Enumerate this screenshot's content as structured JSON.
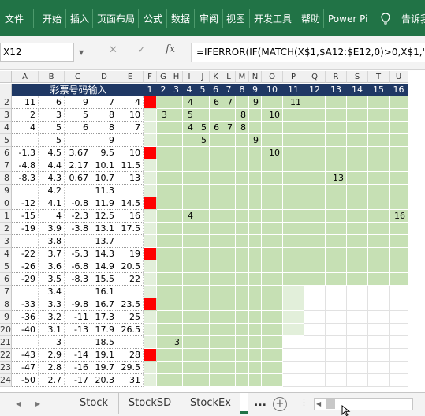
{
  "ribbon": {
    "tabs": [
      "文件",
      "开始",
      "插入",
      "页面布局",
      "公式",
      "数据",
      "审阅",
      "视图",
      "开发工具",
      "帮助",
      "Power Pi",
      "告诉我"
    ],
    "colors": {
      "bg": "#217346",
      "text": "#ffffff"
    }
  },
  "formula_bar": {
    "name_box": "X12",
    "cancel_icon": "✕",
    "enter_icon": "✓",
    "fx_label": "fx",
    "formula": "=IFERROR(IF(MATCH(X$1,$A12:$E12,0)>0,X$1,\"\"),\"\")"
  },
  "columns": [
    "A",
    "B",
    "C",
    "D",
    "E",
    "F",
    "G",
    "H",
    "I",
    "J",
    "K",
    "L",
    "M",
    "N",
    "O",
    "P",
    "Q",
    "R",
    "S",
    "T",
    "U"
  ],
  "title": "彩票号码输入",
  "header_numbers": [
    "1",
    "2",
    "3",
    "4",
    "5",
    "6",
    "7",
    "8",
    "9",
    "10",
    "11",
    "12",
    "13",
    "14",
    "15",
    "16"
  ],
  "rows": [
    {
      "num": "2",
      "a": "11",
      "b": "6",
      "c": "9",
      "d": "7",
      "e": "4",
      "f": "red",
      "vals": {
        "J": "4",
        "L": "6",
        "M": "7",
        "O": "9",
        "Q": "11"
      }
    },
    {
      "num": "3",
      "a": "2",
      "b": "3",
      "c": "5",
      "d": "8",
      "e": "10",
      "f": "lite",
      "vals": {
        "G": "2",
        "H": "3",
        "J": "5",
        "N": "8",
        "P": "10"
      }
    },
    {
      "num": "4",
      "a": "4",
      "b": "5",
      "c": "6",
      "d": "8",
      "e": "7",
      "f": "lite",
      "vals": {
        "J": "4",
        "K": "5",
        "L": "6",
        "M": "7",
        "N": "8"
      }
    },
    {
      "num": "5",
      "a": "",
      "b": "5",
      "c": "",
      "d": "9",
      "e": "",
      "f": "lite",
      "vals": {
        "K": "5",
        "O": "9"
      }
    },
    {
      "num": "6",
      "a": "-1.3",
      "b": "4.5",
      "c": "3.67",
      "d": "9.5",
      "e": "10",
      "f": "red",
      "vals": {
        "P": "10"
      }
    },
    {
      "num": "7",
      "a": "-4.8",
      "b": "4.4",
      "c": "2.17",
      "d": "10.1",
      "e": "11.5",
      "f": "lite",
      "vals": {}
    },
    {
      "num": "8",
      "a": "-8.3",
      "b": "4.3",
      "c": "0.67",
      "d": "10.7",
      "e": "13",
      "f": "lite",
      "vals": {
        "S": "13"
      }
    },
    {
      "num": "9",
      "a": "",
      "b": "4.2",
      "c": "",
      "d": "11.3",
      "e": "",
      "f": "lite",
      "vals": {}
    },
    {
      "num": "0",
      "a": "-12",
      "b": "4.1",
      "c": "-0.8",
      "d": "11.9",
      "e": "14.5",
      "f": "red",
      "vals": {}
    },
    {
      "num": "1",
      "a": "-15",
      "b": "4",
      "c": "-2.3",
      "d": "12.5",
      "e": "16",
      "f": "lite",
      "vals": {
        "J": "4",
        "V": "16"
      }
    },
    {
      "num": "2",
      "a": "-19",
      "b": "3.9",
      "c": "-3.8",
      "d": "13.1",
      "e": "17.5",
      "f": "lite",
      "vals": {}
    },
    {
      "num": "3",
      "a": "",
      "b": "3.8",
      "c": "",
      "d": "13.7",
      "e": "",
      "f": "lite",
      "vals": {}
    },
    {
      "num": "4",
      "a": "-22",
      "b": "3.7",
      "c": "-5.3",
      "d": "14.3",
      "e": "19",
      "f": "red",
      "vals": {}
    },
    {
      "num": "5",
      "a": "-26",
      "b": "3.6",
      "c": "-6.8",
      "d": "14.9",
      "e": "20.5",
      "f": "lite",
      "vals": {}
    },
    {
      "num": "6",
      "a": "-29",
      "b": "3.5",
      "c": "-8.3",
      "d": "15.5",
      "e": "22",
      "f": "lite",
      "vals": {}
    },
    {
      "num": "7",
      "a": "",
      "b": "3.4",
      "c": "",
      "d": "16.1",
      "e": "",
      "f": "lite",
      "vals": {}
    },
    {
      "num": "8",
      "a": "-33",
      "b": "3.3",
      "c": "-9.8",
      "d": "16.7",
      "e": "23.5",
      "f": "red",
      "vals": {}
    },
    {
      "num": "9",
      "a": "-36",
      "b": "3.2",
      "c": "-11",
      "d": "17.3",
      "e": "25",
      "f": "lite",
      "vals": {}
    },
    {
      "num": "20",
      "a": "-40",
      "b": "3.1",
      "c": "-13",
      "d": "17.9",
      "e": "26.5",
      "f": "lite",
      "vals": {}
    },
    {
      "num": "21",
      "a": "",
      "b": "3",
      "c": "",
      "d": "18.5",
      "e": "",
      "f": "lite",
      "vals": {
        "I": "3"
      }
    },
    {
      "num": "22",
      "a": "-43",
      "b": "2.9",
      "c": "-14",
      "d": "19.1",
      "e": "28",
      "f": "red",
      "vals": {}
    },
    {
      "num": "23",
      "a": "-47",
      "b": "2.8",
      "c": "-16",
      "d": "19.7",
      "e": "29.5",
      "f": "lite",
      "vals": {}
    },
    {
      "num": "24",
      "a": "-50",
      "b": "2.7",
      "c": "-17",
      "d": "20.3",
      "e": "31",
      "f": "lite",
      "vals": {}
    }
  ],
  "sheet_tabs": [
    "Stock",
    "StockSD",
    "StockEx"
  ],
  "overflow_dots": "...",
  "add_sheet": "+",
  "colors": {
    "green_fill": "#c6e0b4",
    "light_fill": "#e2efda",
    "red_fill": "#ff0000",
    "navy": "#1f3864"
  }
}
